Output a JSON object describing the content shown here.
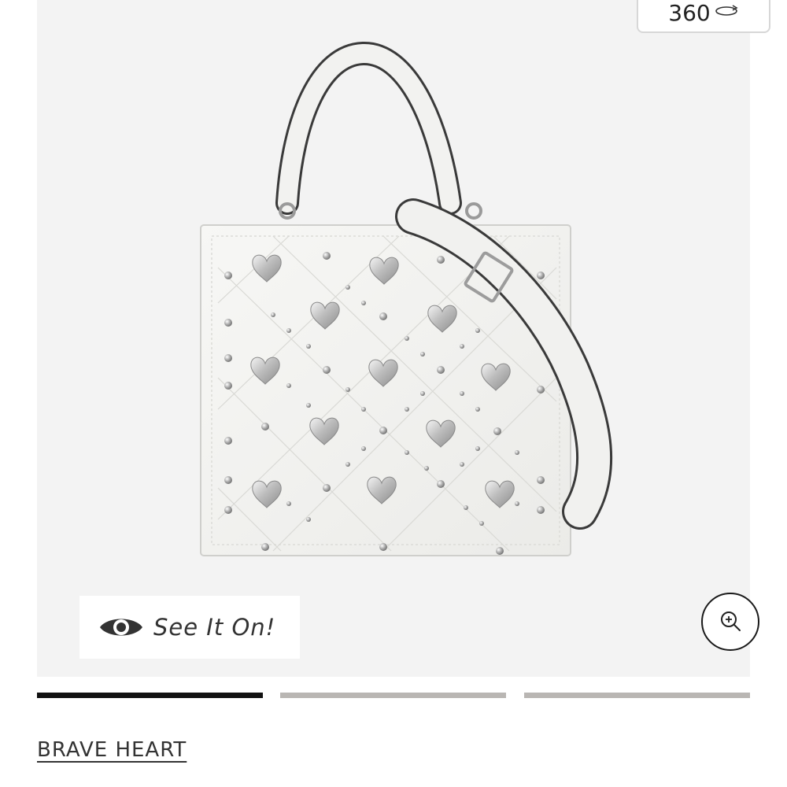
{
  "gallery": {
    "view_360_label": "360",
    "view_360_icon": "rotate-360-icon",
    "see_it_on_label": "See It On!",
    "see_it_on_icon": "eye-icon",
    "zoom_icon": "zoom-in-icon",
    "product_image": "white-studded-heart-tote-bag",
    "slide_count": 3,
    "active_slide": 1
  },
  "product": {
    "collection_label": "BRAVE HEART"
  },
  "colors": {
    "gallery_background": "#f3f3f3",
    "indicator_active": "#111111",
    "indicator_inactive": "#b9b6b3"
  }
}
